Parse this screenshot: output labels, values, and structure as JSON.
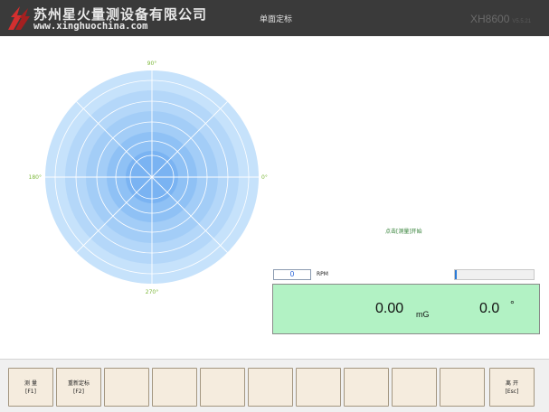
{
  "header": {
    "company_name": "苏州星火量测设备有限公司",
    "website": "www.xinghuochina.com",
    "page_title": "单面定标",
    "model": "XH8600",
    "version": "V5.5.21"
  },
  "polar": {
    "angle_labels": {
      "deg90": "90°",
      "deg180": "180°",
      "deg0": "0°",
      "deg270": "270°"
    }
  },
  "status": {
    "hint": "点击[测量]开始"
  },
  "rpm": {
    "value": "0",
    "unit": "RPM"
  },
  "progress": {
    "fraction": 0.01
  },
  "result": {
    "magnitude": "0.00",
    "magnitude_unit": "mG",
    "angle": "0.0",
    "angle_unit": "°"
  },
  "fkeys": [
    {
      "line1": "测 量",
      "line2": "[F1]"
    },
    {
      "line1": "重新定标",
      "line2": "[F2]"
    },
    {
      "line1": "",
      "line2": ""
    },
    {
      "line1": "",
      "line2": ""
    },
    {
      "line1": "",
      "line2": ""
    },
    {
      "line1": "",
      "line2": ""
    },
    {
      "line1": "",
      "line2": ""
    },
    {
      "line1": "",
      "line2": ""
    },
    {
      "line1": "",
      "line2": ""
    },
    {
      "line1": "",
      "line2": ""
    },
    {
      "line1": "离 开",
      "line2": "[Esc]"
    }
  ],
  "colors": {
    "header_bg": "#3a3a3a",
    "logo_red": "#d32f2f",
    "polar_ring_1": "#c6e2fb",
    "polar_ring_2": "#b4d7f9",
    "polar_ring_3": "#a3cdf7",
    "polar_ring_4": "#8fc1f5",
    "polar_core": "#7ab3f2",
    "result_bg": "#b2f2c4",
    "progress_fill": "#2a7ad8",
    "fkey_bg": "#f5ecde"
  }
}
